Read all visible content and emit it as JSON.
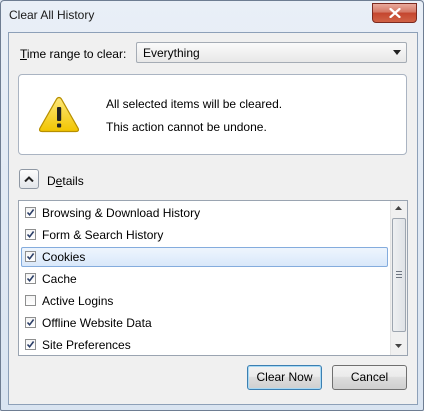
{
  "window": {
    "title": "Clear All History"
  },
  "time_range": {
    "label_accel": "T",
    "label_rest": "ime range to clear:",
    "selected": "Everything"
  },
  "warning": {
    "line1": "All selected items will be cleared.",
    "line2": "This action cannot be undone."
  },
  "details": {
    "label_pre": "D",
    "label_accel": "e",
    "label_rest": "tails",
    "expanded": true
  },
  "items": [
    {
      "label": "Browsing & Download History",
      "checked": true
    },
    {
      "label": "Form & Search History",
      "checked": true
    },
    {
      "label": "Cookies",
      "checked": true,
      "selected": true
    },
    {
      "label": "Cache",
      "checked": true
    },
    {
      "label": "Active Logins",
      "checked": false
    },
    {
      "label": "Offline Website Data",
      "checked": true
    },
    {
      "label": "Site Preferences",
      "checked": true
    }
  ],
  "buttons": {
    "clear_now": "Clear Now",
    "cancel": "Cancel"
  },
  "colors": {
    "selection_border": "#84acdd",
    "default_button_border": "#3c7fb1",
    "close_button": "#c4462f",
    "warning_yellow": "#f2c500"
  }
}
